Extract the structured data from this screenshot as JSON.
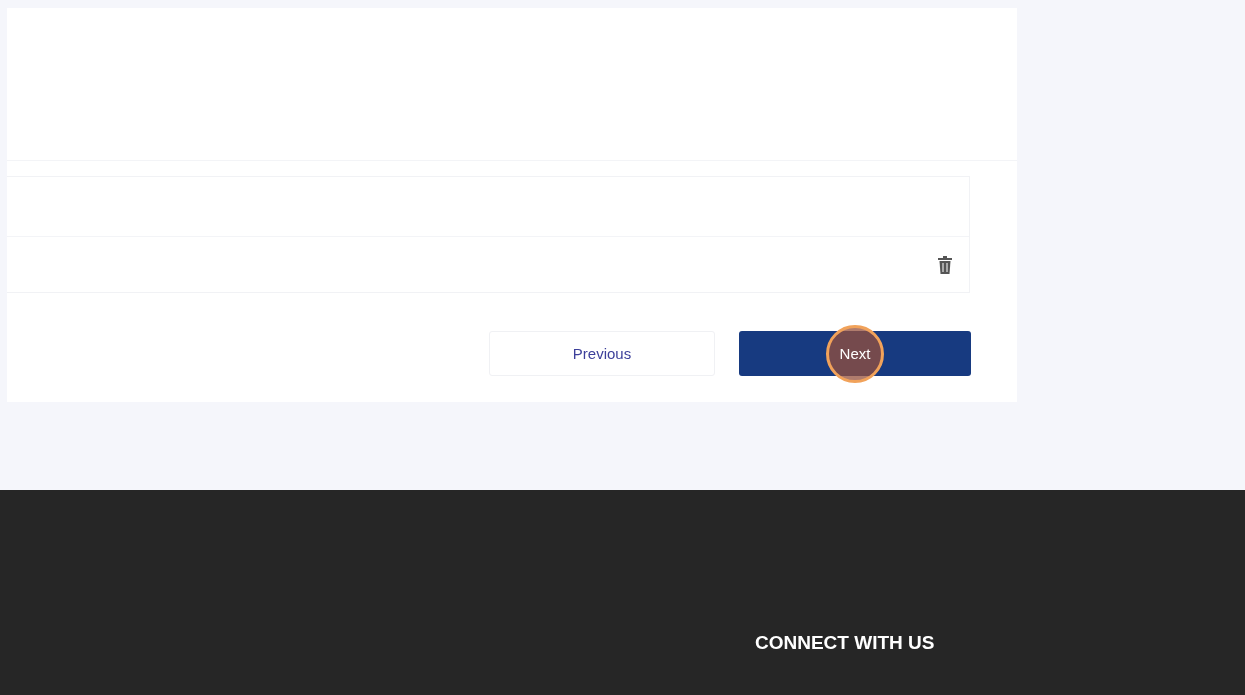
{
  "buttons": [
    {
      "label": "Previous",
      "kind": "secondary",
      "highlighted": false
    },
    {
      "label": "Next",
      "kind": "primary",
      "highlighted": true
    }
  ],
  "footer": {
    "heading": "CONNECT WITH US"
  }
}
